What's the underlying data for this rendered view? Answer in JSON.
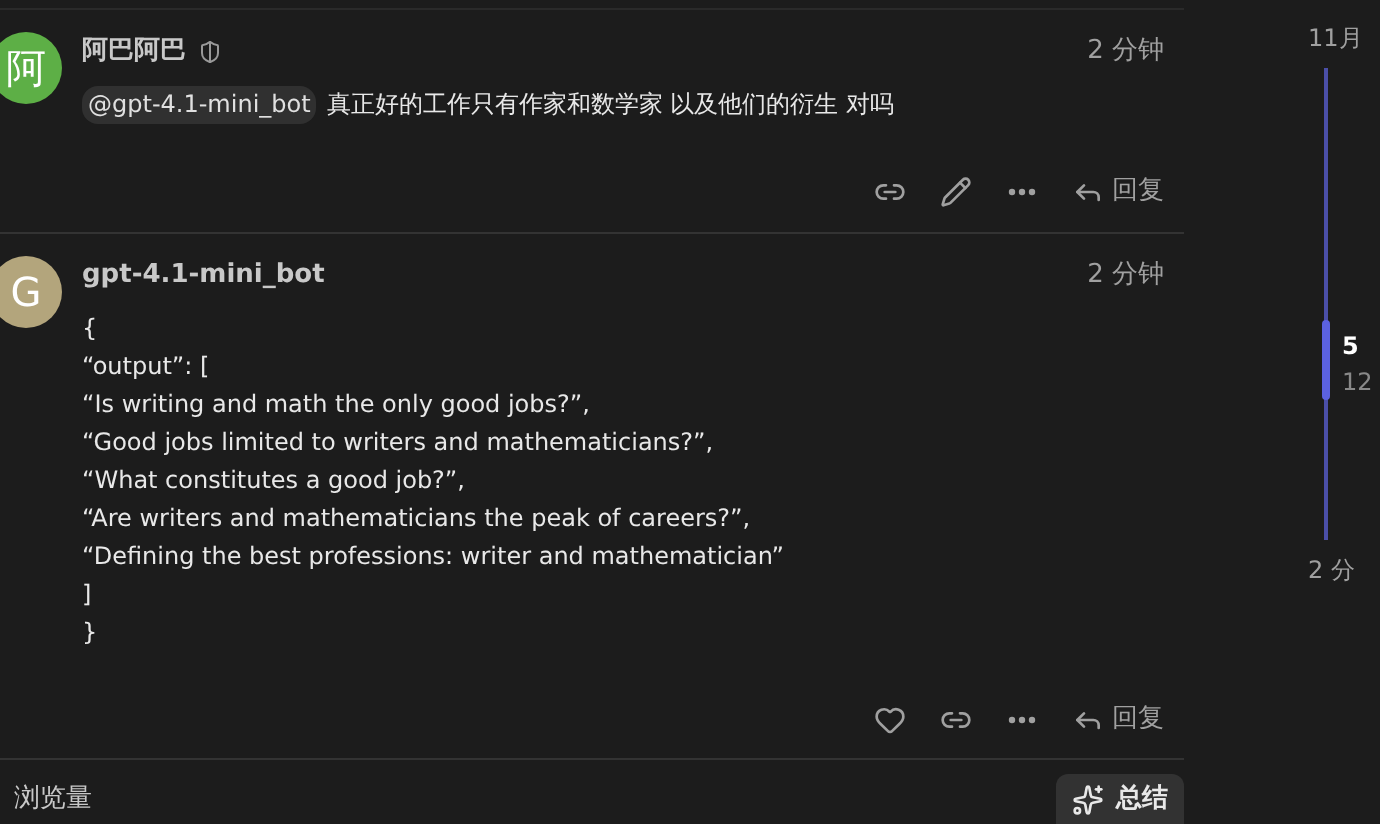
{
  "posts": [
    {
      "avatar_letter": "阿",
      "color": "#5daf46",
      "author": "阿巴阿巴",
      "moderator": true,
      "time": "2 分钟",
      "mention": "@gpt-4.1-mini_bot",
      "body": [
        "真正好的工作只有作家和数学家 以及他们的衍生 对吗"
      ],
      "actions": [
        {
          "kind": "link"
        },
        {
          "kind": "edit"
        },
        {
          "kind": "more"
        }
      ],
      "reply": "回复"
    },
    {
      "avatar_letter": "G",
      "color": "#b3a57c",
      "author": "gpt-4.1-mini_bot",
      "moderator": false,
      "time": "2 分钟",
      "body": [
        "{",
        "“output”: [",
        "“Is writing and math the only good jobs?”,",
        "“Good jobs limited to writers and mathematicians?”,",
        "“What constitutes a good job?”,",
        "“Are writers and mathematicians the peak of careers?”,",
        "“Defining the best professions: writer and mathematician”",
        "]",
        "}"
      ],
      "actions": [
        {
          "kind": "like"
        },
        {
          "kind": "link"
        },
        {
          "kind": "more"
        }
      ],
      "reply": "回复"
    }
  ],
  "footer": {
    "views": "浏览量",
    "summary_button": "总结"
  },
  "timeline": {
    "start": "11月",
    "current": "5",
    "current_sub": "12",
    "end": "2 分"
  }
}
